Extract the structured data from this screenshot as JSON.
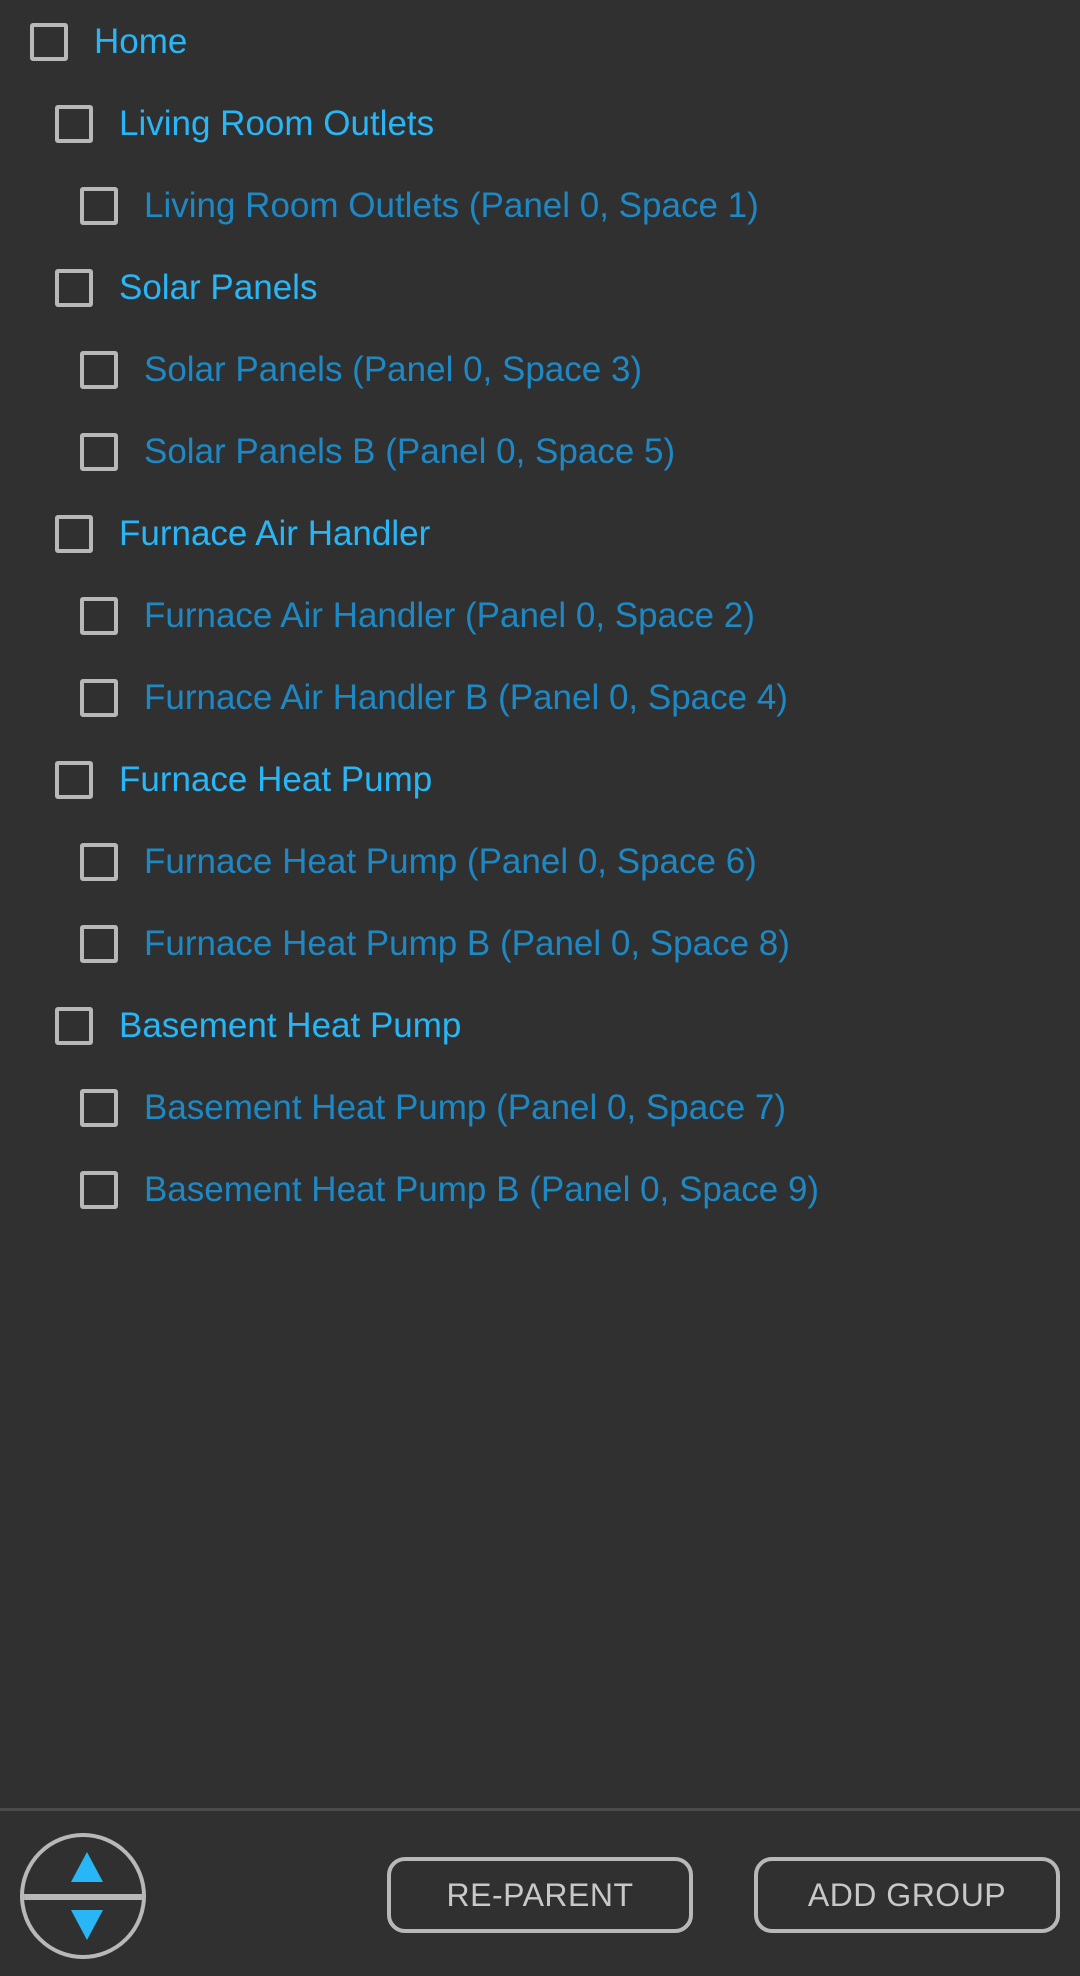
{
  "tree": [
    {
      "label": "Home",
      "level": 0
    },
    {
      "label": "Living Room Outlets",
      "level": 1
    },
    {
      "label": "Living Room Outlets (Panel 0, Space 1)",
      "level": 2
    },
    {
      "label": "Solar Panels",
      "level": 1
    },
    {
      "label": "Solar Panels (Panel 0, Space 3)",
      "level": 2
    },
    {
      "label": "Solar Panels B (Panel 0, Space 5)",
      "level": 2
    },
    {
      "label": "Furnace Air Handler",
      "level": 1
    },
    {
      "label": "Furnace Air Handler (Panel 0, Space 2)",
      "level": 2
    },
    {
      "label": "Furnace Air Handler B (Panel 0, Space 4)",
      "level": 2
    },
    {
      "label": "Furnace Heat Pump",
      "level": 1
    },
    {
      "label": "Furnace Heat Pump (Panel 0, Space 6)",
      "level": 2
    },
    {
      "label": "Furnace Heat Pump B (Panel 0, Space 8)",
      "level": 2
    },
    {
      "label": "Basement Heat Pump",
      "level": 1
    },
    {
      "label": "Basement Heat Pump (Panel 0, Space 7)",
      "level": 2
    },
    {
      "label": "Basement Heat Pump B (Panel 0, Space 9)",
      "level": 2
    }
  ],
  "bottom_bar": {
    "reparent_label": "RE-PARENT",
    "add_group_label": "ADD GROUP"
  },
  "colors": {
    "background": "#303030",
    "accent": "#29b6f6",
    "child_text": "#1e88c4",
    "outline": "#b8b8b8"
  }
}
